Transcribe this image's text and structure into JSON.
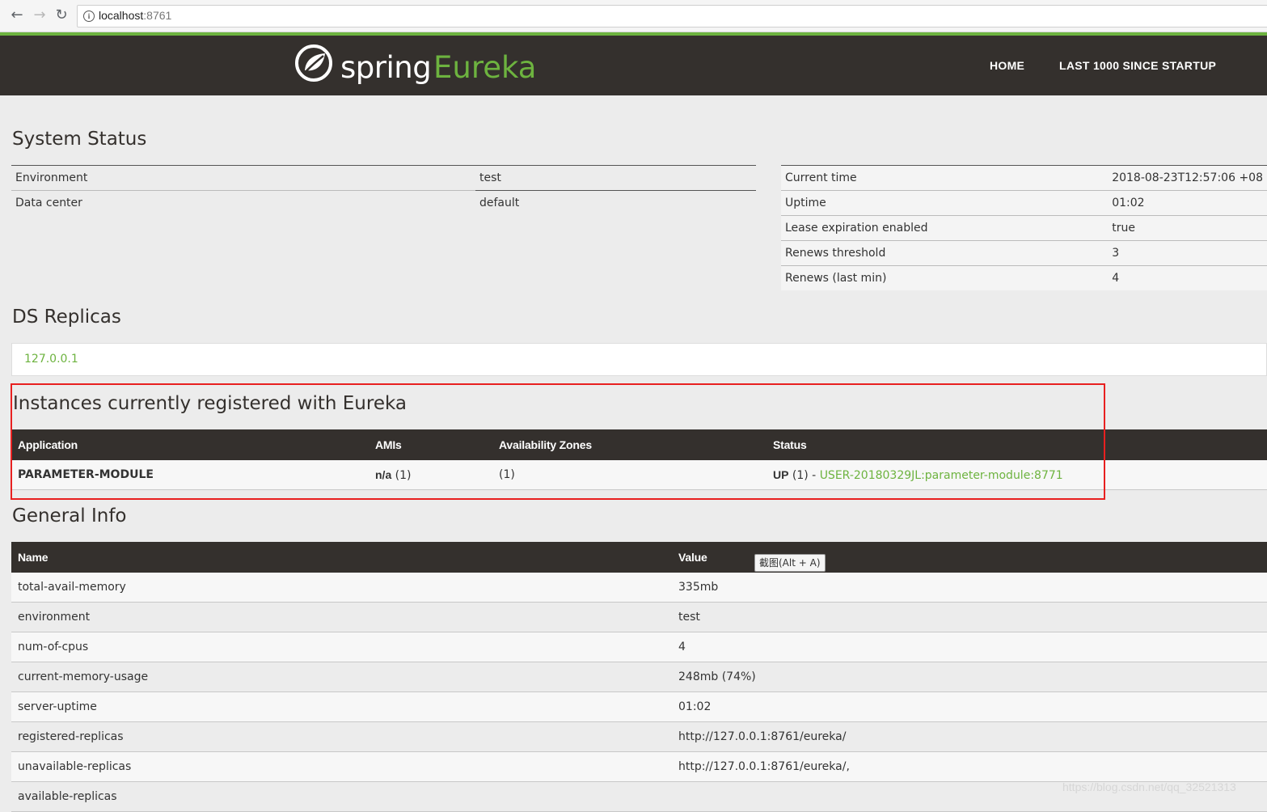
{
  "browser": {
    "url_host": "localhost",
    "url_port": ":8761"
  },
  "header": {
    "logo_spring": "spring",
    "logo_eureka": "Eureka",
    "nav_home": "HOME",
    "nav_last": "LAST 1000 SINCE STARTUP"
  },
  "system_status": {
    "title": "System Status",
    "left": [
      {
        "label": "Environment",
        "value": "test"
      },
      {
        "label": "Data center",
        "value": "default"
      }
    ],
    "right": [
      {
        "label": "Current time",
        "value": "2018-08-23T12:57:06 +08"
      },
      {
        "label": "Uptime",
        "value": "01:02"
      },
      {
        "label": "Lease expiration enabled",
        "value": "true"
      },
      {
        "label": "Renews threshold",
        "value": "3"
      },
      {
        "label": "Renews (last min)",
        "value": "4"
      }
    ]
  },
  "ds_replicas": {
    "title": "DS Replicas",
    "replica": "127.0.0.1"
  },
  "instances": {
    "title": "Instances currently registered with Eureka",
    "columns": [
      "Application",
      "AMIs",
      "Availability Zones",
      "Status"
    ],
    "row": {
      "application": "PARAMETER-MODULE",
      "amis_bold": "n/a",
      "amis_count": " (1)",
      "zones": "(1)",
      "status_bold": "UP",
      "status_count": " (1) - ",
      "status_link": "USER-20180329JL:parameter-module:8771"
    }
  },
  "general_info": {
    "title": "General Info",
    "columns": [
      "Name",
      "Value"
    ],
    "rows": [
      {
        "name": "total-avail-memory",
        "value": "335mb"
      },
      {
        "name": "environment",
        "value": "test"
      },
      {
        "name": "num-of-cpus",
        "value": "4"
      },
      {
        "name": "current-memory-usage",
        "value": "248mb (74%)"
      },
      {
        "name": "server-uptime",
        "value": "01:02"
      },
      {
        "name": "registered-replicas",
        "value": "http://127.0.0.1:8761/eureka/"
      },
      {
        "name": "unavailable-replicas",
        "value": "http://127.0.0.1:8761/eureka/,"
      },
      {
        "name": "available-replicas",
        "value": ""
      }
    ]
  },
  "tooltip": "截图(Alt + A)",
  "watermark": "https://blog.csdn.net/qq_32521313",
  "colors": {
    "brand_green": "#6db33f",
    "header_dark": "#34302d",
    "highlight_red": "#e82020"
  }
}
